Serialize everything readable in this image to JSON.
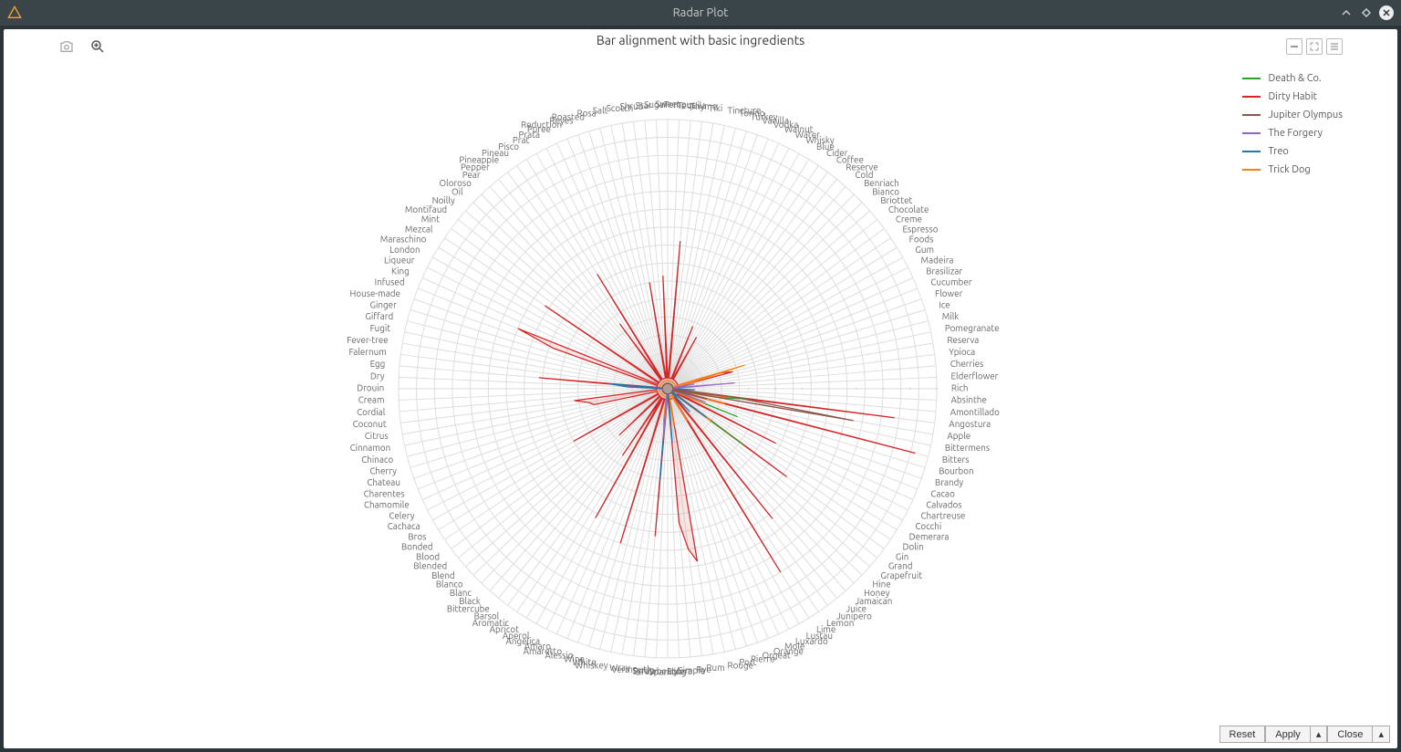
{
  "window": {
    "title": "Radar Plot"
  },
  "chart_title": "Bar alignment with basic ingredients",
  "legend": [
    {
      "name": "Death & Co.",
      "color": "#2ca02c"
    },
    {
      "name": "Dirty Habit",
      "color": "#d62728"
    },
    {
      "name": "Jupiter Olympus",
      "color": "#8c564b"
    },
    {
      "name": "The Forgery",
      "color": "#9467bd"
    },
    {
      "name": "Treo",
      "color": "#1f77b4"
    },
    {
      "name": "Trick Dog",
      "color": "#ff7f0e"
    }
  ],
  "buttons": {
    "reset": "Reset",
    "apply": "Apply",
    "close": "Close"
  },
  "categories": [
    "Rich",
    "Elderflower",
    "Cherries",
    "Ypioca",
    "Reserva",
    "Pomegranate",
    "Milk",
    "Ice",
    "Flower",
    "Cucumber",
    "Brasilizar",
    "Madeira",
    "Gum",
    "Foods",
    "Espresso",
    "Creme",
    "Chocolate",
    "Briottet",
    "Bianco",
    "Benriach",
    "Cold",
    "Reserve",
    "Coffee",
    "Cider",
    "Blue",
    "Whisky",
    "Water",
    "Walnut",
    "Vodka",
    "Vanilla",
    "Turkey",
    "Torino",
    "Tincture",
    "Tiki",
    "Thyme",
    "Tequila",
    "Tempus",
    "Sweet",
    "Sugar",
    "Star",
    "Shrub",
    "Scotch",
    "Salt",
    "Rosa",
    "Roasted",
    "Reyes",
    "Reduction",
    "Puree",
    "Prata",
    "Prat",
    "Pisco",
    "Pineau",
    "Pineapple",
    "Pepper",
    "Pear",
    "Oloroso",
    "Oil",
    "Noilly",
    "Montifaud",
    "Mint",
    "Mezcal",
    "Maraschino",
    "London",
    "Liqueur",
    "King",
    "Infused",
    "House-made",
    "Ginger",
    "Giffard",
    "Fugit",
    "Fever-tree",
    "Falernum",
    "Egg",
    "Dry",
    "Drouin",
    "Cream",
    "Cordial",
    "Coconut",
    "Citrus",
    "Cinnamon",
    "Chinaco",
    "Cherry",
    "Chateau",
    "Charentes",
    "Chamomile",
    "Celery",
    "Cachaca",
    "Bros",
    "Bonded",
    "Blood",
    "Blended",
    "Blend",
    "Blanco",
    "Blanc",
    "Black",
    "Bittercube",
    "Barsol",
    "Aromatic",
    "Apricot",
    "Aperol",
    "Angelica",
    "Amaro",
    "Amaretto",
    "Alessio",
    "Wine",
    "White",
    "Whiskey",
    "Wray",
    "Vermouth",
    "Syrup",
    "Strawberry",
    "Sparkling",
    "Solera",
    "Simple",
    "Rye",
    "Rum",
    "Rouge",
    "Port",
    "Pierre",
    "Orgeat",
    "Orange",
    "Mole",
    "Luxardo",
    "Lustau",
    "Lime",
    "Lemon",
    "Junipero",
    "Juice",
    "Jamaican",
    "Honey",
    "Hine",
    "Grapefruit",
    "Grand",
    "Gin",
    "Dolin",
    "Demerara",
    "Cocchi",
    "Chartreuse",
    "Calvados",
    "Cacao",
    "Brandy",
    "Bourbon",
    "Bitters",
    "Bittermens",
    "Apple",
    "Angostura",
    "Amontillado",
    "Absinthe"
  ],
  "radial_ticks": [
    10,
    20,
    30,
    40,
    50,
    60,
    70,
    80,
    90,
    100
  ],
  "chart_data": {
    "type": "radar",
    "title": "Bar alignment with basic ingredients",
    "radial_range": [
      0,
      100
    ],
    "categories_note": "148 ingredient spokes distributed evenly around the circle starting at 3 o'clock going counter-clockwise",
    "series": [
      {
        "name": "Death & Co.",
        "color": "#2ca02c",
        "notable_peaks": {
          "Gin": 35,
          "Cacao": 28,
          "Angostura": 30,
          "Apple": 20,
          "Bitters": 15
        }
      },
      {
        "name": "Dirty Habit",
        "color": "#d62728",
        "notable_peaks": {
          "Bitters": 95,
          "Angostura": 85,
          "Lime": 80,
          "Rum": 65,
          "Rye": 60,
          "Juice": 62,
          "Gin": 55,
          "Simple": 50,
          "Syrup": 55,
          "Aperol": 55,
          "Chartreuse": 45,
          "Egg": 48,
          "Cachaca": 40,
          "Infused": 60,
          "House-made": 45,
          "Mezcal": 55,
          "Pisco": 50,
          "Scotch": 40,
          "Sugar": 42,
          "Tequila": 55,
          "Vodka": 25,
          "Wine": 60,
          "Coconut": 35,
          "Citrus": 30,
          "Cinnamon": 28,
          "Blanco": 25,
          "Aromatic": 30,
          "Milk": 25,
          "Ice": 20,
          "Whisky": 22,
          "Pineapple": 30
        }
      },
      {
        "name": "Jupiter Olympus",
        "color": "#8c564b",
        "notable_peaks": {
          "Apple": 70,
          "Angostura": 25,
          "Bitters": 15
        }
      },
      {
        "name": "The Forgery",
        "color": "#9467bd",
        "notable_peaks": {
          "Cherries": 25,
          "Syrup": 18,
          "Brandy": 15,
          "Reserva": 10
        }
      },
      {
        "name": "Treo",
        "color": "#1f77b4",
        "notable_peaks": {
          "Syrup": 35,
          "Simple": 20,
          "Gin": 18,
          "Egg": 22,
          "Dry": 15,
          "Absinthe": 10,
          "Honey": 12
        }
      },
      {
        "name": "Trick Dog",
        "color": "#ff7f0e",
        "notable_peaks": {
          "Gin": 20,
          "Bitters": 22,
          "Angostura": 25,
          "Apple": 18,
          "Cacao": 15,
          "Lime": 14,
          "Syrup": 16,
          "Vermouth": 12,
          "Rum": 14,
          "Ice": 30,
          "Milk": 10
        }
      }
    ]
  }
}
